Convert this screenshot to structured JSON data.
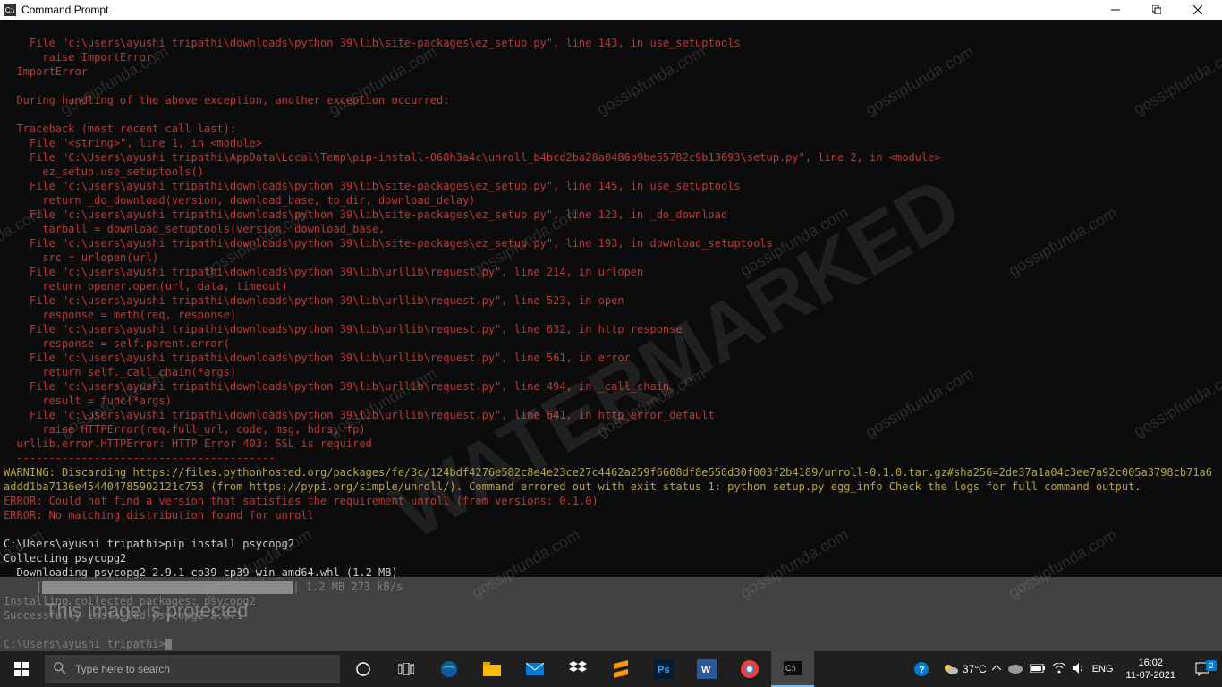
{
  "window": {
    "title": "Command Prompt"
  },
  "terminal": {
    "lines_red_1": "    File \"c:\\users\\ayushi tripathi\\downloads\\python 39\\lib\\site-packages\\ez_setup.py\", line 143, in use_setuptools\n      raise ImportError\n  ImportError\n\n  During handling of the above exception, another exception occurred:\n\n  Traceback (most recent call last):\n    File \"<string>\", line 1, in <module>\n    File \"C:\\Users\\ayushi tripathi\\AppData\\Local\\Temp\\pip-install-068h3a4c\\unroll_b4bcd2ba28a0486b9be55782c9b13693\\setup.py\", line 2, in <module>\n      ez_setup.use_setuptools()\n    File \"c:\\users\\ayushi tripathi\\downloads\\python 39\\lib\\site-packages\\ez_setup.py\", line 145, in use_setuptools\n      return _do_download(version, download_base, to_dir, download_delay)\n    File \"c:\\users\\ayushi tripathi\\downloads\\python 39\\lib\\site-packages\\ez_setup.py\", line 123, in _do_download\n      tarball = download_setuptools(version, download_base,\n    File \"c:\\users\\ayushi tripathi\\downloads\\python 39\\lib\\site-packages\\ez_setup.py\", line 193, in download_setuptools\n      src = urlopen(url)\n    File \"c:\\users\\ayushi tripathi\\downloads\\python 39\\lib\\urllib\\request.py\", line 214, in urlopen\n      return opener.open(url, data, timeout)\n    File \"c:\\users\\ayushi tripathi\\downloads\\python 39\\lib\\urllib\\request.py\", line 523, in open\n      response = meth(req, response)\n    File \"c:\\users\\ayushi tripathi\\downloads\\python 39\\lib\\urllib\\request.py\", line 632, in http_response\n      response = self.parent.error(\n    File \"c:\\users\\ayushi tripathi\\downloads\\python 39\\lib\\urllib\\request.py\", line 561, in error\n      return self._call_chain(*args)\n    File \"c:\\users\\ayushi tripathi\\downloads\\python 39\\lib\\urllib\\request.py\", line 494, in _call_chain\n      result = func(*args)\n    File \"c:\\users\\ayushi tripathi\\downloads\\python 39\\lib\\urllib\\request.py\", line 641, in http_error_default\n      raise HTTPError(req.full_url, code, msg, hdrs, fp)\n  urllib.error.HTTPError: HTTP Error 403: SSL is required\n  ----------------------------------------",
    "warning": "WARNING: Discarding https://files.pythonhosted.org/packages/fe/3c/124bdf4276e582c8e4e23ce27c4462a259f6608df8e550d30f003f2b4189/unroll-0.1.0.tar.gz#sha256=2de37a1a04c3ee7a92c005a3798cb71a6addd1ba7136e454404785902121c753 (from https://pypi.org/simple/unroll/). Command errored out with exit status 1: python setup.py egg_info Check the logs for full command output.",
    "errors": "ERROR: Could not find a version that satisfies the requirement unroll (from versions: 0.1.0)\nERROR: No matching distribution found for unroll",
    "prompt1": "C:\\Users\\ayushi tripathi>pip install psycopg2",
    "collecting": "Collecting psycopg2",
    "downloading": "  Downloading psycopg2-2.9.1-cp39-cp39-win_amd64.whl (1.2 MB)",
    "progress_text": " 1.2 MB 273 kB/s",
    "installing": "Installing collected packages: psycopg2",
    "success": "Successfully installed psycopg2-2.9.1",
    "prompt2": "C:\\Users\\ayushi tripathi>"
  },
  "watermark": {
    "text": "gossipfunda.com",
    "big": "WATERMARKED",
    "protected": "This image is protected"
  },
  "taskbar": {
    "search_placeholder": "Type here to search",
    "weather": "37°C",
    "lang": "ENG",
    "time": "16:02",
    "date": "11-07-2021",
    "notif_count": "2"
  }
}
